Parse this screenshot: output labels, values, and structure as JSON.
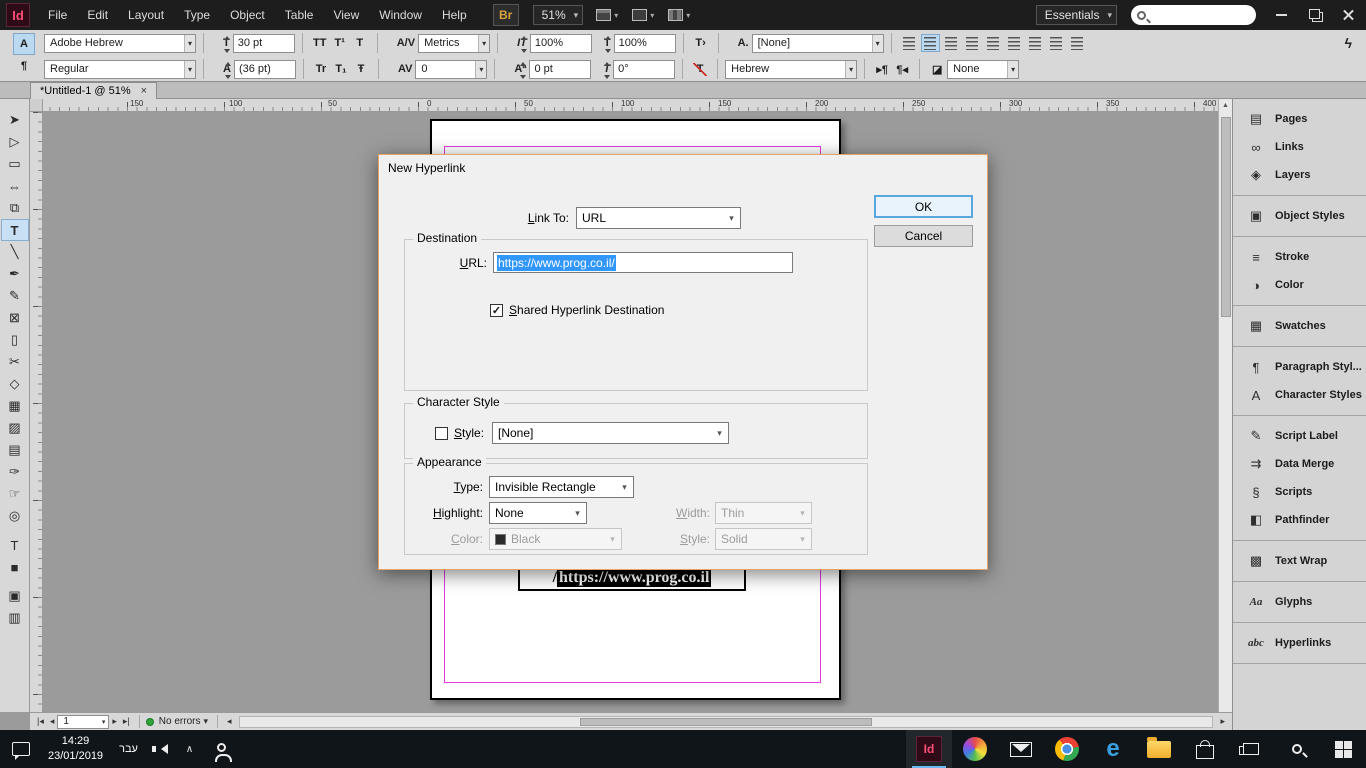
{
  "menubar": {
    "logo": "Id",
    "items": [
      "File",
      "Edit",
      "Layout",
      "Type",
      "Object",
      "Table",
      "View",
      "Window",
      "Help"
    ],
    "bridge": "Br",
    "zoom_value": "51%",
    "workspace": "Essentials",
    "search_value": ""
  },
  "controlbar": {
    "char_mode": "A",
    "para_mode": "¶",
    "font_family": "Adobe Hebrew",
    "font_style": "Regular",
    "font_size": "30 pt",
    "leading": "(36 pt)",
    "kerning": "Metrics",
    "tracking": "0",
    "vertical_scale": "100%",
    "horizontal_scale": "100%",
    "baseline_shift": "0 pt",
    "skew": "0°",
    "character_style": "[None]",
    "language": "Hebrew",
    "object_style": "None",
    "case_buttons": [
      "TT",
      "T¹",
      "T"
    ],
    "position_buttons": [
      "Tr",
      "T₁",
      "Ŧ"
    ],
    "icons": {
      "size": "T",
      "leading": "A",
      "kerning": "A/V",
      "tracking": "AV",
      "vscale": "IT",
      "hscale": "T",
      "baseline": "Aª",
      "skew": "T",
      "no_break": "T›",
      "strike": "T",
      "charstyle": "A.",
      "ltr_dir": "▸¶",
      "rtl_dir": "¶◂",
      "wrap": "◪",
      "quick_apply": "ϟ"
    }
  },
  "tab": {
    "title": "*Untitled-1 @ 51%",
    "close": "×"
  },
  "ruler_labels": [
    "00",
    "150",
    "100",
    "50",
    "0",
    "50",
    "100",
    "150",
    "200",
    "250",
    "300",
    "350",
    "400"
  ],
  "tools": [
    {
      "name": "selection-tool",
      "glyph": "➤"
    },
    {
      "name": "direct-selection-tool",
      "glyph": "▷"
    },
    {
      "name": "page-tool",
      "glyph": "▭"
    },
    {
      "name": "gap-tool",
      "glyph": "⇔"
    },
    {
      "name": "content-collector-tool",
      "glyph": "⧉"
    },
    {
      "name": "type-tool",
      "glyph": "T"
    },
    {
      "name": "line-tool",
      "glyph": "╲"
    },
    {
      "name": "pen-tool",
      "glyph": "✒"
    },
    {
      "name": "pencil-tool",
      "glyph": "✎"
    },
    {
      "name": "rectangle-frame-tool",
      "glyph": "⊠"
    },
    {
      "name": "rectangle-tool",
      "glyph": "▯"
    },
    {
      "name": "scissors-tool",
      "glyph": "✂"
    },
    {
      "name": "free-transform-tool",
      "glyph": "◇"
    },
    {
      "name": "gradient-swatch-tool",
      "glyph": "▦"
    },
    {
      "name": "gradient-feather-tool",
      "glyph": "▨"
    },
    {
      "name": "note-tool",
      "glyph": "▤"
    },
    {
      "name": "eyedropper-tool",
      "glyph": "✑"
    },
    {
      "name": "hand-tool",
      "glyph": "☞"
    },
    {
      "name": "zoom-tool",
      "glyph": "◎"
    },
    {
      "name": "formatting-affects-text-button",
      "glyph": "T"
    },
    {
      "name": "fill-indicator",
      "glyph": "■"
    },
    {
      "name": "normal-view-button",
      "glyph": "▣"
    },
    {
      "name": "screen-mode-button",
      "glyph": "▥"
    }
  ],
  "canvas": {
    "text_prefix": "/",
    "selected_text": "https://www.prog.co.il"
  },
  "dialog": {
    "title": "New Hyperlink",
    "link_to_label": "Link To:",
    "link_to_value": "URL",
    "ok": "OK",
    "cancel": "Cancel",
    "destination": {
      "legend": "Destination",
      "url_label": "URL:",
      "url_value": "https://www.prog.co.il/",
      "shared_label": "Shared Hyperlink Destination",
      "shared_checked": true
    },
    "character_style": {
      "legend": "Character Style",
      "style_label": "Style:",
      "style_checked": false,
      "style_value": "[None]"
    },
    "appearance": {
      "legend": "Appearance",
      "type_label": "Type:",
      "type_value": "Invisible Rectangle",
      "highlight_label": "Highlight:",
      "highlight_value": "None",
      "width_label": "Width:",
      "width_value": "Thin",
      "color_label": "Color:",
      "color_value": "Black",
      "style_label": "Style:",
      "style_value": "Solid"
    }
  },
  "right_panel": {
    "groups": [
      {
        "items": [
          {
            "icon": "pages-icon",
            "glyph": "▤",
            "label": "Pages"
          },
          {
            "icon": "links-icon",
            "glyph": "∞",
            "label": "Links"
          },
          {
            "icon": "layers-icon",
            "glyph": "◈",
            "label": "Layers"
          }
        ]
      },
      {
        "items": [
          {
            "icon": "object-styles-icon",
            "glyph": "▣",
            "label": "Object Styles"
          }
        ]
      },
      {
        "items": [
          {
            "icon": "stroke-icon",
            "glyph": "≡",
            "label": "Stroke"
          },
          {
            "icon": "color-icon",
            "glyph": "◑",
            "label": "Color"
          }
        ]
      },
      {
        "items": [
          {
            "icon": "swatches-icon",
            "glyph": "▦",
            "label": "Swatches"
          }
        ]
      },
      {
        "items": [
          {
            "icon": "paragraph-styles-icon",
            "glyph": "¶",
            "label": "Paragraph Styl..."
          },
          {
            "icon": "character-styles-icon",
            "glyph": "A",
            "label": "Character Styles"
          }
        ]
      },
      {
        "items": [
          {
            "icon": "script-label-icon",
            "glyph": "✎",
            "label": "Script Label"
          },
          {
            "icon": "data-merge-icon",
            "glyph": "⇉",
            "label": "Data Merge"
          },
          {
            "icon": "scripts-icon",
            "glyph": "§",
            "label": "Scripts"
          },
          {
            "icon": "pathfinder-icon",
            "glyph": "◧",
            "label": "Pathfinder"
          }
        ]
      },
      {
        "items": [
          {
            "icon": "text-wrap-icon",
            "glyph": "▩",
            "label": "Text Wrap"
          }
        ]
      },
      {
        "items": [
          {
            "icon": "glyphs-icon",
            "glyph": "Aa",
            "label": "Glyphs"
          }
        ]
      },
      {
        "items": [
          {
            "icon": "hyperlinks-icon",
            "glyph": "abc",
            "label": "Hyperlinks"
          }
        ]
      }
    ]
  },
  "statusbar": {
    "nav": [
      "|◂",
      "◂",
      "▸",
      "▸|"
    ],
    "page": "1",
    "status": "No errors"
  },
  "taskbar": {
    "time": "14:29",
    "date": "23/01/2019",
    "language": "עבר"
  }
}
